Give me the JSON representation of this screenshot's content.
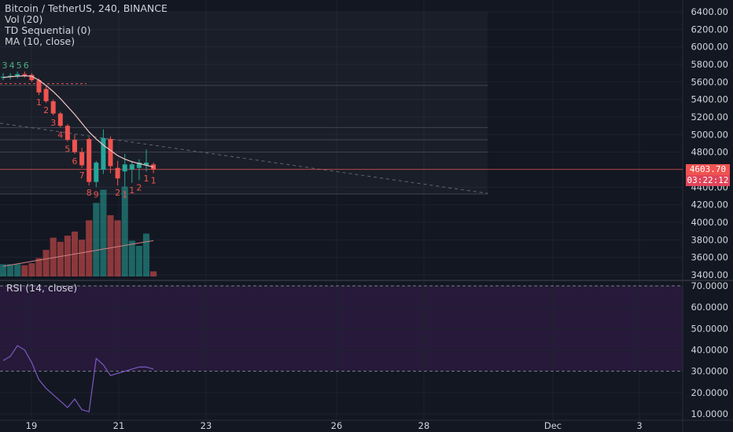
{
  "legend": {
    "symbol": "Bitcoin / TetherUS, 240, BINANCE",
    "vol": "Vol (20)",
    "td": "TD Sequential (0)",
    "ma": "MA (10, close)"
  },
  "rsi_title": "RSI (14, close)",
  "last_price": "4603.70",
  "countdown": "03:22:12",
  "colors": {
    "background": "#131722",
    "up": "#26a69a",
    "down": "#ef5350",
    "rsi_band": "#2a1a3d",
    "rsi_line": "#7e57c2",
    "ma_line": "#f4c6c6",
    "price_line": "#ef5350"
  },
  "chart_data": {
    "type": "candlestick",
    "price_axis_ticks": [
      "6400.00",
      "6200.00",
      "6000.00",
      "5800.00",
      "5600.00",
      "5400.00",
      "5200.00",
      "5000.00",
      "4800.00",
      "4600.00",
      "4400.00",
      "4200.00",
      "4000.00",
      "3800.00",
      "3600.00",
      "3400.00"
    ],
    "rsi_axis_ticks": [
      "70.0000",
      "60.0000",
      "50.0000",
      "40.0000",
      "30.0000",
      "20.0000",
      "10.0000"
    ],
    "x_ticks": [
      "19",
      "21",
      "23",
      "26",
      "28",
      "Dec",
      "3"
    ],
    "candles": [
      {
        "o": 5650,
        "h": 5700,
        "l": 5620,
        "c": 5660
      },
      {
        "o": 5660,
        "h": 5700,
        "l": 5630,
        "c": 5670
      },
      {
        "o": 5670,
        "h": 5720,
        "l": 5640,
        "c": 5690
      },
      {
        "o": 5690,
        "h": 5720,
        "l": 5650,
        "c": 5680
      },
      {
        "o": 5680,
        "h": 5700,
        "l": 5600,
        "c": 5620
      },
      {
        "o": 5620,
        "h": 5640,
        "l": 5450,
        "c": 5480
      },
      {
        "o": 5520,
        "h": 5560,
        "l": 5360,
        "c": 5380
      },
      {
        "o": 5380,
        "h": 5400,
        "l": 5220,
        "c": 5240
      },
      {
        "o": 5240,
        "h": 5260,
        "l": 5080,
        "c": 5100
      },
      {
        "o": 5100,
        "h": 5120,
        "l": 4920,
        "c": 4940
      },
      {
        "o": 4940,
        "h": 5000,
        "l": 4780,
        "c": 4800
      },
      {
        "o": 4800,
        "h": 4850,
        "l": 4620,
        "c": 4650
      },
      {
        "o": 4950,
        "h": 4970,
        "l": 4420,
        "c": 4460
      },
      {
        "o": 4460,
        "h": 4700,
        "l": 4400,
        "c": 4680
      },
      {
        "o": 4600,
        "h": 5060,
        "l": 4550,
        "c": 4960
      },
      {
        "o": 4950,
        "h": 4980,
        "l": 4560,
        "c": 4640
      },
      {
        "o": 4620,
        "h": 4700,
        "l": 4420,
        "c": 4500
      },
      {
        "o": 4580,
        "h": 4780,
        "l": 4400,
        "c": 4660
      },
      {
        "o": 4600,
        "h": 4700,
        "l": 4450,
        "c": 4660
      },
      {
        "o": 4620,
        "h": 4720,
        "l": 4480,
        "c": 4680
      },
      {
        "o": 4650,
        "h": 4830,
        "l": 4580,
        "c": 4680
      },
      {
        "o": 4660,
        "h": 4680,
        "l": 4560,
        "c": 4600
      }
    ],
    "volume": [
      0.12,
      0.12,
      0.12,
      0.11,
      0.13,
      0.18,
      0.26,
      0.38,
      0.34,
      0.4,
      0.44,
      0.36,
      0.55,
      0.72,
      0.85,
      0.6,
      0.55,
      0.88,
      0.35,
      0.3,
      0.42,
      0.05
    ],
    "ma": [
      5650,
      5660,
      5665,
      5670,
      5665,
      5620,
      5560,
      5490,
      5410,
      5320,
      5230,
      5130,
      5030,
      4950,
      4880,
      4820,
      4760,
      4720,
      4690,
      4670,
      4650,
      4630
    ],
    "rsi": [
      35,
      37,
      42,
      40,
      34,
      26,
      22,
      19,
      16,
      13,
      17,
      12,
      11,
      36,
      33,
      28,
      29,
      30,
      31,
      32,
      32,
      31
    ],
    "td_labels_above": [
      "3",
      "4",
      "5",
      "6"
    ],
    "td_labels_below": [
      "1",
      "2",
      "3",
      "4",
      "5",
      "6",
      "7",
      "8",
      "9",
      "2",
      "1",
      "1",
      "2",
      "1",
      "1"
    ]
  }
}
